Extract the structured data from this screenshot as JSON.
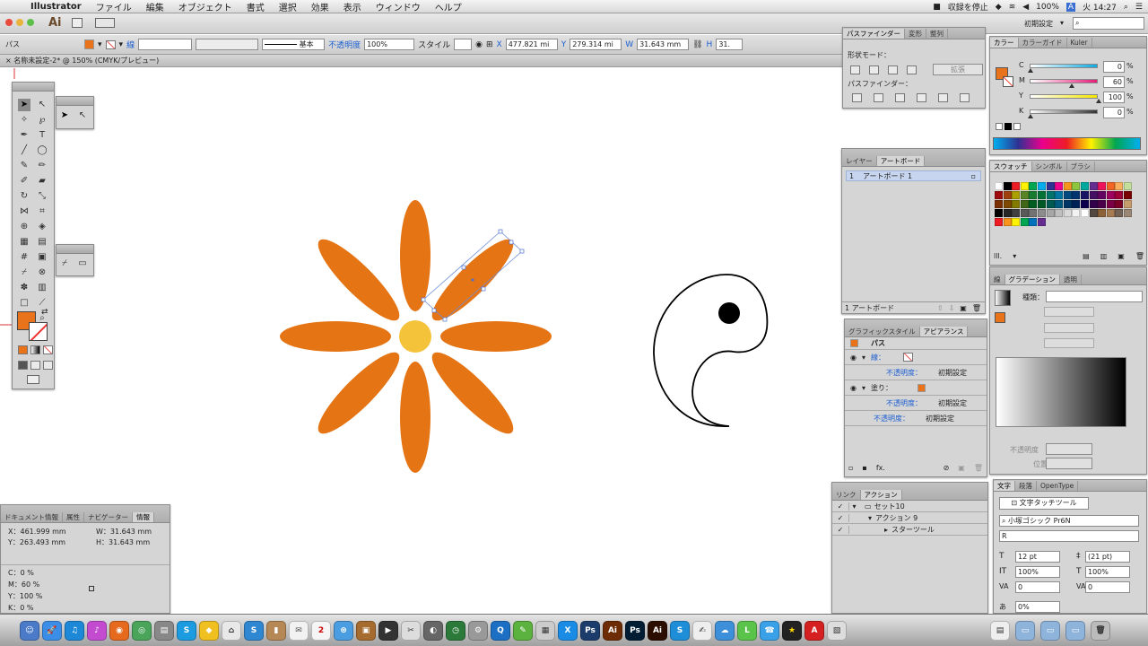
{
  "menubar": {
    "app": "Illustrator",
    "items": [
      "ファイル",
      "編集",
      "オブジェクト",
      "書式",
      "選択",
      "効果",
      "表示",
      "ウィンドウ",
      "ヘルプ"
    ],
    "recording": "収録を停止",
    "battery": "100%",
    "clock": "火 14:27"
  },
  "appbar": {
    "ai_label": "Ai",
    "workspace": "初期設定"
  },
  "control": {
    "object_type": "パス",
    "stroke_label": "線",
    "stroke_style": "基本",
    "opacity_label": "不透明度",
    "opacity": "100%",
    "style_label": "スタイル",
    "x_label": "X",
    "x": "477.821 mi",
    "y_label": "Y",
    "y": "279.314 mi",
    "w_label": "W",
    "w": "31.643 mm",
    "h_label": "H",
    "h": "31."
  },
  "document": {
    "tab": "名称未設定-2* @ 150% (CMYK/プレビュー)"
  },
  "pathfinder": {
    "tabs": [
      "パスファインダー",
      "変形",
      "整列"
    ],
    "shape_modes": "形状モード：",
    "expand": "拡張",
    "pathfinders": "パスファインダー："
  },
  "color": {
    "tabs": [
      "カラー",
      "カラーガイド",
      "Kuler"
    ],
    "channels": [
      {
        "label": "C",
        "value": "0",
        "pct": "%"
      },
      {
        "label": "M",
        "value": "60",
        "pct": "%"
      },
      {
        "label": "Y",
        "value": "100",
        "pct": "%"
      },
      {
        "label": "K",
        "value": "0",
        "pct": "%"
      }
    ],
    "fill": "#e8731a",
    "slider_colors": [
      "#10a9df",
      "#e51c7a",
      "#f3e600",
      "#333333"
    ],
    "slider_levels": [
      0,
      0.6,
      1,
      0
    ]
  },
  "layers": {
    "tabs": [
      "レイヤー",
      "アートボード"
    ],
    "row_number": "1",
    "row_name": "アートボード 1",
    "footer": "1 アートボード"
  },
  "swatches": {
    "tabs": [
      "スウォッチ",
      "シンボル",
      "ブラシ"
    ]
  },
  "gradient": {
    "tabs": [
      "線",
      "グラデーション",
      "透明"
    ],
    "type_label": "種類：",
    "opacity_label": "不透明度",
    "position_label": "位置"
  },
  "appearance": {
    "tabs": [
      "グラフィックスタイル",
      "アピアランス"
    ],
    "title": "パス",
    "rows": [
      {
        "label": "線：",
        "value": ""
      },
      {
        "label": "不透明度：",
        "value": "初期設定"
      },
      {
        "label": "塗り：",
        "value": ""
      },
      {
        "label": "不透明度：",
        "value": "初期設定"
      },
      {
        "label": "不透明度：",
        "value": "初期設定"
      }
    ]
  },
  "actions": {
    "tabs": [
      "リンク",
      "アクション"
    ],
    "rows": [
      "セット10",
      "アクション 9",
      "スターツール"
    ]
  },
  "info": {
    "tabs": [
      "ドキュメント情報",
      "属性",
      "ナビゲーター",
      "情報"
    ],
    "x": "X：461.999 mm",
    "y": "Y：263.493 mm",
    "w": "W：31.643 mm",
    "h": "H：31.643 mm",
    "c": "C：0 %",
    "m": "M：60 %",
    "yc": "Y：100 %",
    "k": "K：0 %"
  },
  "character": {
    "tabs": [
      "文字",
      "段落",
      "OpenType"
    ],
    "touch_tool": "文字タッチツール",
    "font": "小塚ゴシック Pr6N",
    "style": "R",
    "size": "12 pt",
    "leading": "(21 pt)",
    "hscale": "100%",
    "vscale": "100%",
    "kerning": "0",
    "tracking": "0",
    "tsume": "0%"
  },
  "tools": {
    "fill_color": "#e8731a"
  },
  "dock": {
    "items": [
      {
        "label": "Ps",
        "color": "#1c3d6b"
      },
      {
        "label": "Ai",
        "color": "#6d2c06"
      },
      {
        "label": "Ps",
        "color": "#001d34"
      },
      {
        "label": "Ai",
        "color": "#2b0e00"
      }
    ]
  },
  "art": {
    "petal_color": "#e57415",
    "center_color": "#f5c33a"
  }
}
